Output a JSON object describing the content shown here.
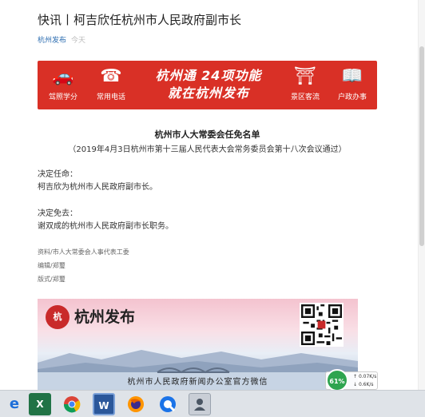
{
  "article": {
    "title": "快讯丨柯吉欣任杭州市人民政府副市长",
    "source": "杭州发布",
    "date": "今天",
    "heading": "杭州市人大常委会任免名单",
    "subheading": "（2019年4月3日杭州市第十三届人民代表大会常务委员会第十八次会议通过）",
    "appoint_label": "决定任命：",
    "appoint_text": "柯吉欣为杭州市人民政府副市长。",
    "remove_label": "决定免去：",
    "remove_text": "谢双成的杭州市人民政府副市长职务。",
    "credit_source": "资料/市人大常委会人事代表工委",
    "credit_editor": "编辑/郑璽",
    "credit_layout": "版式/郑璽"
  },
  "banner": {
    "headline_line1": "杭州通  24项功能",
    "headline_line2": "就在杭州发布",
    "items": [
      {
        "label": "驾照学分",
        "icon": "car-icon"
      },
      {
        "label": "常用电话",
        "icon": "phone-icon"
      },
      {
        "label": "景区客流",
        "icon": "pagoda-icon"
      },
      {
        "label": "户政办事",
        "icon": "booklet-icon"
      }
    ]
  },
  "poster": {
    "logo_mark": "杭",
    "brand": "杭州发布",
    "caption": "杭州市人民政府新闻办公室官方微信"
  },
  "netmon": {
    "percent": "61%",
    "up": "0.07K/s",
    "down": "0.6K/s"
  },
  "taskbar": {
    "apps": [
      "ie-icon",
      "excel-icon",
      "chrome-icon",
      "word-icon",
      "firefox-icon",
      "qq-browser-icon",
      "user-icon"
    ]
  }
}
